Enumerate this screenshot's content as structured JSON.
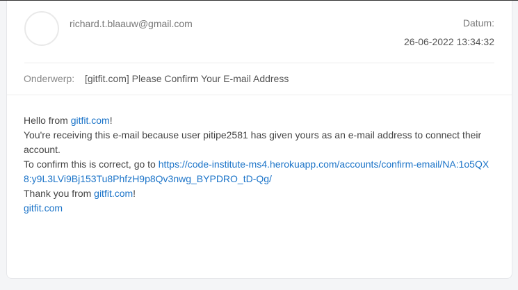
{
  "email": {
    "sender": "richard.t.blaauw@gmail.com",
    "date_label": "Datum:",
    "date_value": "26-06-2022 13:34:32",
    "subject_label": "Onderwerp:",
    "subject": "[gitfit.com] Please Confirm Your E-mail Address",
    "body": {
      "line1_prefix": "Hello from ",
      "line1_link": "gitfit.com",
      "line1_suffix": "!",
      "line2": "You're receiving this e-mail because user pitipe2581 has given yours as an e-mail address to connect their account.",
      "line3_prefix": "To confirm this is correct, go to ",
      "line3_link": "https://code-institute-ms4.herokuapp.com/accounts/confirm-email/NA:1o5QX8:y9L3LVi9Bj153Tu8PhfzH9p8Qv3nwg_BYPDRO_tD-Qg/",
      "line4_prefix": "Thank you from ",
      "line4_link": "gitfit.com",
      "line4_suffix": "!",
      "line5_link": "gitfit.com"
    }
  }
}
